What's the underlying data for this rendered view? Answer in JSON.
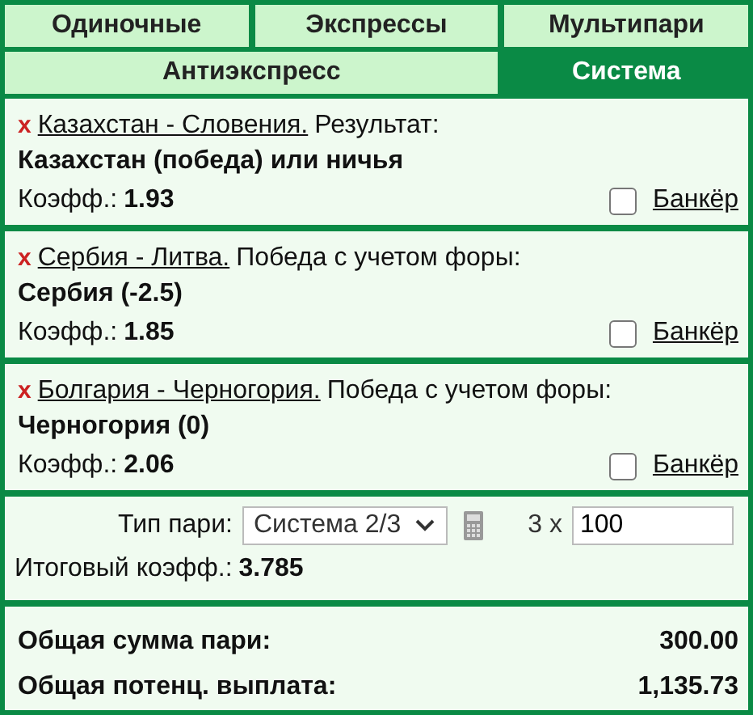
{
  "tabs": [
    {
      "label": "Одиночные",
      "selected": false
    },
    {
      "label": "Экспрессы",
      "selected": false
    },
    {
      "label": "Мультипари",
      "selected": false
    },
    {
      "label": "Антиэкспресс",
      "selected": false
    },
    {
      "label": "Система",
      "selected": true
    }
  ],
  "bets": [
    {
      "remove": "x",
      "event": "Казахстан - Словения.",
      "market": "Результат:",
      "outcome": "Казахстан (победа) или ничья",
      "odds_label": "Коэфф.:",
      "odds": "1.93",
      "banker_label": "Банкёр",
      "banker": false
    },
    {
      "remove": "x",
      "event": "Сербия - Литва.",
      "market": "Победа с учетом форы:",
      "outcome": "Сербия (-2.5)",
      "odds_label": "Коэфф.:",
      "odds": "1.85",
      "banker_label": "Банкёр",
      "banker": false
    },
    {
      "remove": "x",
      "event": "Болгария - Черногория.",
      "market": "Победа с учетом форы:",
      "outcome": "Черногория (0)",
      "odds_label": "Коэфф.:",
      "odds": "2.06",
      "banker_label": "Банкёр",
      "banker": false
    }
  ],
  "system": {
    "type_label": "Тип пари:",
    "type_value": "Система 2/3",
    "multiplier": "3 x",
    "stake": "100",
    "total_odds_label": "Итоговый коэфф.:",
    "total_odds": "3.785"
  },
  "totals": [
    {
      "label": "Общая сумма пари:",
      "value": "300.00"
    },
    {
      "label": "Общая потенц. выплата:",
      "value": "1,135.73"
    }
  ]
}
